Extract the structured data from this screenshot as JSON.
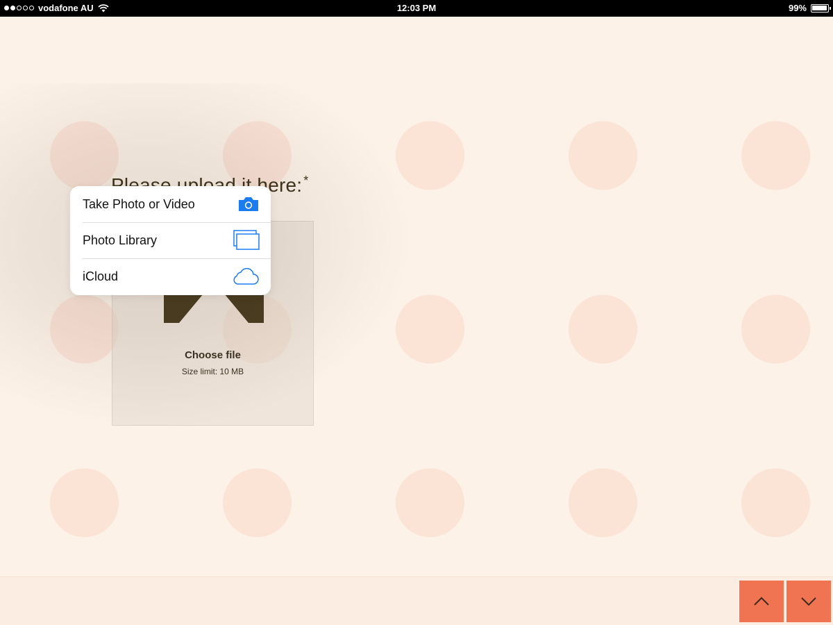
{
  "status_bar": {
    "carrier": "vodafone AU",
    "time": "12:03 PM",
    "battery": "99%"
  },
  "question": {
    "number": "→",
    "title": "Please upload it here:",
    "required_marker": "*"
  },
  "upload": {
    "choose_file_label": "Choose file",
    "size_limit_label": "Size limit: 10 MB",
    "icon": "upload-arrows-icon"
  },
  "popover_menu": {
    "items": [
      {
        "label": "Take Photo or Video",
        "icon": "camera-icon"
      },
      {
        "label": "Photo Library",
        "icon": "photo-library-icon"
      },
      {
        "label": "iCloud",
        "icon": "icloud-icon"
      }
    ]
  },
  "navigation": {
    "up_icon": "chevron-up-icon",
    "down_icon": "chevron-down-icon"
  },
  "colors": {
    "background": "#fdf2e8",
    "polka_dot": "#fbe3d6",
    "accent": "#f07352",
    "ios_blue": "#1b7cf0",
    "text_dark": "#3c3219"
  }
}
